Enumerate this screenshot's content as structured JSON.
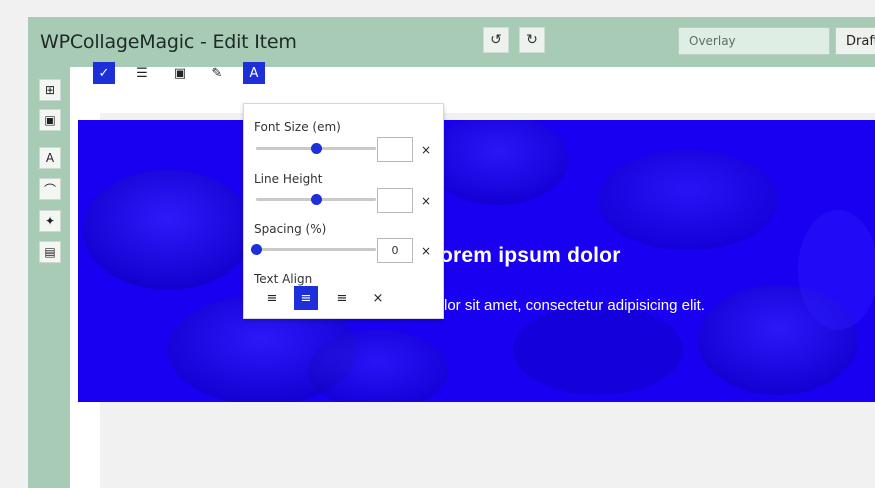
{
  "header": {
    "title": "WPCollageMagic - Edit Item",
    "undo_icon": "undo-icon",
    "redo_icon": "redo-icon",
    "overlay_field": "Overlay",
    "status_field": "Draft"
  },
  "sidebar": {
    "items": [
      {
        "icon": "grid-icon",
        "glyph": "⊞"
      },
      {
        "icon": "image-icon",
        "glyph": "▣"
      },
      {
        "icon": "text-icon",
        "glyph": "A"
      },
      {
        "icon": "bezier-icon",
        "glyph": "⌒"
      },
      {
        "icon": "magic-wand-icon",
        "glyph": "✦"
      },
      {
        "icon": "film-icon",
        "glyph": "▤"
      }
    ]
  },
  "toolbar": {
    "items": [
      {
        "icon": "check-icon",
        "glyph": "✓",
        "active": true
      },
      {
        "icon": "sliders-icon",
        "glyph": "☰",
        "active": false
      },
      {
        "icon": "image-icon",
        "glyph": "▣",
        "active": false
      },
      {
        "icon": "brush-icon",
        "glyph": "✎",
        "active": false
      },
      {
        "icon": "text-format-icon",
        "glyph": "A",
        "active": true
      }
    ]
  },
  "hero": {
    "heading": "Lorem ipsum dolor",
    "subtext": "lor sit amet, consectetur adipisicing elit."
  },
  "typography_popup": {
    "font_size_label": "Font Size (em)",
    "font_size_value": "",
    "font_size_slider": 0.5,
    "line_height_label": "Line Height",
    "line_height_value": "",
    "line_height_slider": 0.5,
    "spacing_label": "Spacing (%)",
    "spacing_value": "0",
    "spacing_slider": 0.0,
    "text_align_label": "Text Align",
    "clear_glyph": "×",
    "align_options": [
      {
        "icon": "align-left-icon",
        "glyph": "≡",
        "active": false
      },
      {
        "icon": "align-center-icon",
        "glyph": "≡",
        "active": true
      },
      {
        "icon": "align-right-icon",
        "glyph": "≡",
        "active": false
      },
      {
        "icon": "clear-align-icon",
        "glyph": "×",
        "active": false
      }
    ]
  },
  "colors": {
    "accent": "#1d2fd8",
    "header_bg": "#a8cbb6",
    "hero_bg": "#1a00f0"
  }
}
